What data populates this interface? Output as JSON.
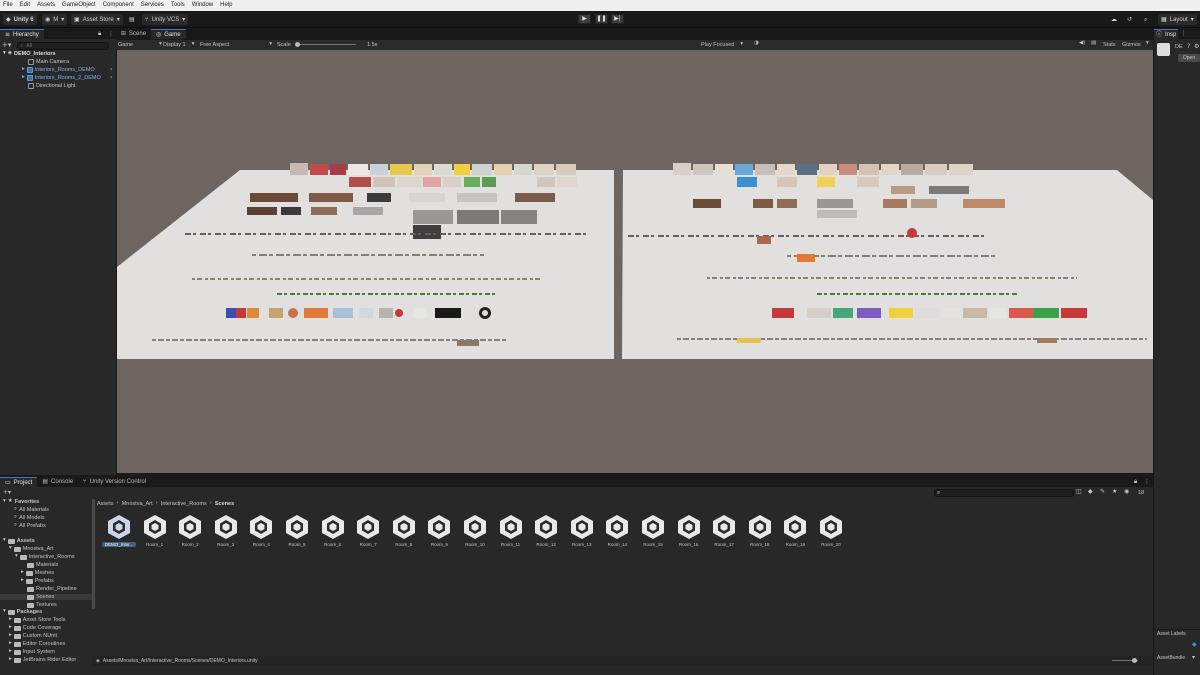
{
  "menu": [
    "File",
    "Edit",
    "Assets",
    "GameObject",
    "Component",
    "Services",
    "Tools",
    "Window",
    "Help"
  ],
  "toolbar": {
    "unity_label": "Unity 6",
    "account_label": "M",
    "asset_store_label": "Asset Store",
    "vcs_label": "Unity VCS",
    "layout_label": "Layout"
  },
  "hierarchy": {
    "tab_label": "Hierarchy",
    "search_placeholder": "All",
    "scene_name": "DEMO_Interiors",
    "items": [
      {
        "label": "Main Camera"
      },
      {
        "label": "Interiors_Rooms_DEMO"
      },
      {
        "label": "Interiors_Rooms_2_DEMO"
      },
      {
        "label": "Directional Light"
      }
    ]
  },
  "game": {
    "tabs": [
      {
        "label": "Scene"
      },
      {
        "label": "Game"
      }
    ],
    "mode_label": "Game",
    "display_label": "Display 1",
    "aspect_label": "Free Aspect",
    "scale_label": "Scale",
    "scale_value": "1.5x",
    "play_focused_label": "Play Focused",
    "stats_label": "Stats",
    "gizmos_label": "Gizmos"
  },
  "inspector": {
    "tab_label": "Insp",
    "short_label": "DE",
    "open_label": "Open",
    "asset_labels_label": "Asset Labels",
    "assetbundle_label": "AssetBundle"
  },
  "project": {
    "tabs": [
      {
        "label": "Project"
      },
      {
        "label": "Console"
      },
      {
        "label": "Unity Version Control"
      }
    ],
    "hidden_count": "18",
    "breadcrumb": [
      "Assets",
      "Mnostva_Art",
      "Interactive_Rooms",
      "Scenes"
    ],
    "favorites_label": "Favorites",
    "favorites": [
      "All Materials",
      "All Models",
      "All Prefabs"
    ],
    "assets_label": "Assets",
    "tree": [
      {
        "label": "Mnostva_Art",
        "level": 1
      },
      {
        "label": "Interactive_Rooms",
        "level": 2
      },
      {
        "label": "Materials",
        "level": 3
      },
      {
        "label": "Meshes",
        "level": 3
      },
      {
        "label": "Prefabs",
        "level": 3
      },
      {
        "label": "Render_Pipeline",
        "level": 3
      },
      {
        "label": "Scenes",
        "level": 3
      },
      {
        "label": "Textures",
        "level": 3
      }
    ],
    "packages_label": "Packages",
    "packages": [
      "Asset Store Tools",
      "Code Coverage",
      "Custom NUnit",
      "Editor Coroutines",
      "Input System",
      "JetBrains Rider Editor"
    ],
    "files": [
      "DEMO_Inter...",
      "Room_1",
      "Room_2",
      "Room_3",
      "Room_4",
      "Room_5",
      "Room_6",
      "Room_7",
      "Room_8",
      "Room_9",
      "Room_10",
      "Room_11",
      "Room_12",
      "Room_13",
      "Room_14",
      "Room_15",
      "Room_16",
      "Room_17",
      "Room_18",
      "Room_19",
      "Room_20"
    ],
    "footer_path": "Assets/Mnostva_Art/Interactive_Rooms/Scenes/DEMO_Interiors.unity"
  },
  "colors": {
    "accent": "#3a79bb",
    "viewport_bg": "#6f6560",
    "panel_bg": "#282828",
    "plane": "#e2e0df"
  }
}
